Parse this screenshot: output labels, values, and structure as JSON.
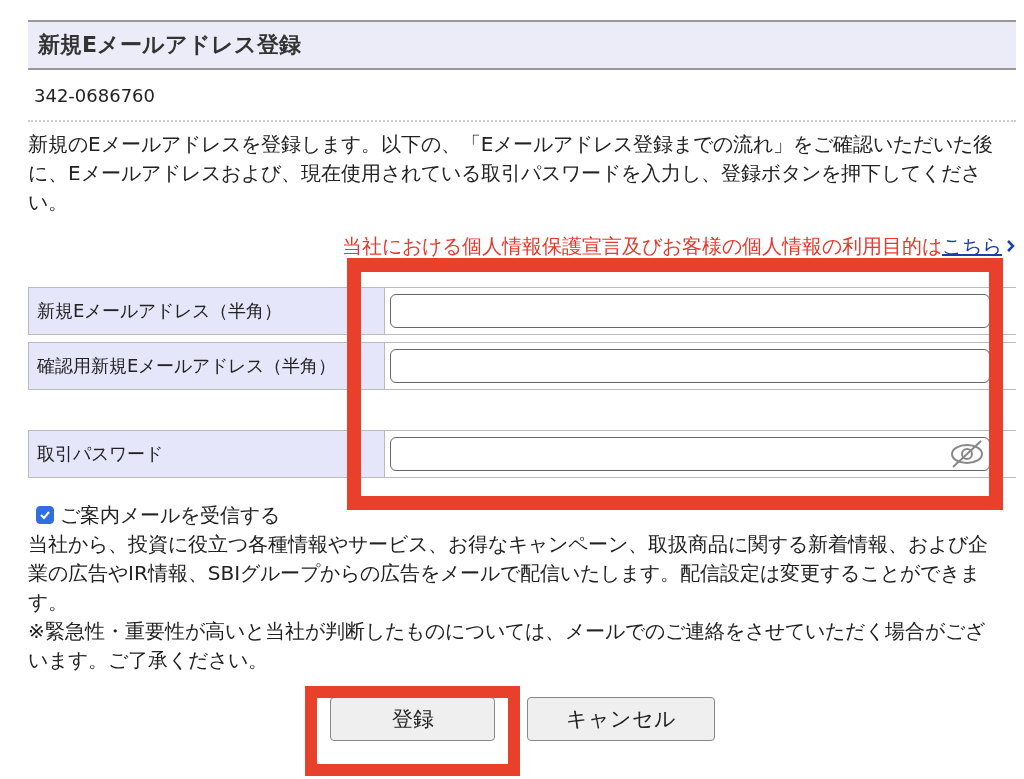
{
  "page": {
    "title": "新規Eメールアドレス登録",
    "account_number": "342-0686760",
    "intro": "新規のEメールアドレスを登録します。以下の、「Eメールアドレス登録までの流れ」をご確認いただいた後に、Eメールアドレスおよび、現在使用されている取引パスワードを入力し、登録ボタンを押下してください。"
  },
  "privacy_notice": {
    "text": "当社における個人情報保護宣言及びお客様の個人情報の利用目的は",
    "link": "こちら"
  },
  "form": {
    "fields": [
      {
        "label": "新規Eメールアドレス（半角）",
        "kind": "text"
      },
      {
        "label": "確認用新規Eメールアドレス（半角）",
        "kind": "text"
      },
      {
        "label": "取引パスワード",
        "kind": "password"
      }
    ]
  },
  "newsletter": {
    "label": "ご案内メールを受信する",
    "checked": true
  },
  "description": "当社から、投資に役立つ各種情報やサービス、お得なキャンペーン、取扱商品に関する新着情報、および企業の広告やIR情報、SBIグループからの広告をメールで配信いたします。配信設定は変更することができます。",
  "note": "※緊急性・重要性が高いと当社が判断したものについては、メールでのご連絡をさせていただく場合がございます。ご了承ください。",
  "buttons": [
    {
      "label": "登録",
      "kind": "primary"
    },
    {
      "label": "キャンセル",
      "kind": "secondary"
    }
  ]
}
